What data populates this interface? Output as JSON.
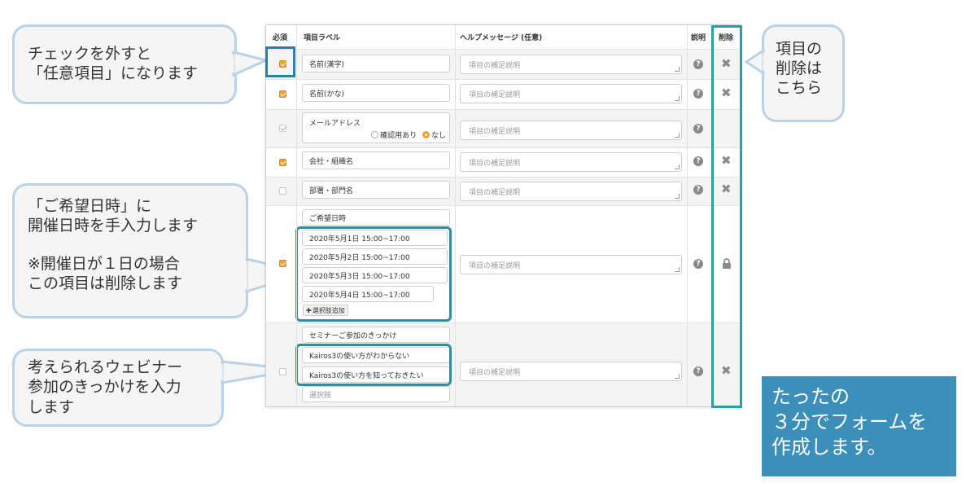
{
  "callouts": {
    "uncheck": [
      "チェックを外すと",
      "「任意項目」になります"
    ],
    "dates": [
      "「ご希望日時」に",
      "開催日時を手入力します",
      "",
      "※開催日が１日の場合",
      "この項目は削除します"
    ],
    "webinar": [
      "考えられるウェビナー",
      "参加のきっかけを入力",
      "します"
    ],
    "delete": [
      "項目の",
      "削除は",
      "こちら"
    ]
  },
  "banner": [
    "たったの",
    "３分でフォームを",
    "作成します。"
  ],
  "table": {
    "headers": {
      "required": "必須",
      "label": "項目ラベル",
      "help": "ヘルプメッセージ (任意)",
      "explain": "説明",
      "delete": "削除"
    },
    "help_placeholder": "項目の補足説明",
    "rows": {
      "name_kanji": "名前(漢字)",
      "name_kana": "名前(かな)",
      "email": "メールアドレス",
      "email_confirm_yes": "確認用あり",
      "email_confirm_no": "なし",
      "company": "会社・組織名",
      "department": "部署・部門名",
      "date_label": "ご希望日時",
      "date_options": [
        "2020年5月1日 15:00~17:00",
        "2020年5月2日 15:00~17:00",
        "2020年5月3日 15:00~17:00",
        "2020年5月4日 15:00~17:00"
      ],
      "add_option": "選択肢追加",
      "seminar_label": "セミナーご参加のきっかけ",
      "seminar_options": [
        "Kairos3の使い方がわからない",
        "Kairos3の使い方を知っておきたい"
      ],
      "seminar_placeholder": "選択肢"
    }
  },
  "colors": {
    "accent": "#f0a22f",
    "highlight": "#2e8ea0",
    "banner": "#3b8fb9"
  }
}
